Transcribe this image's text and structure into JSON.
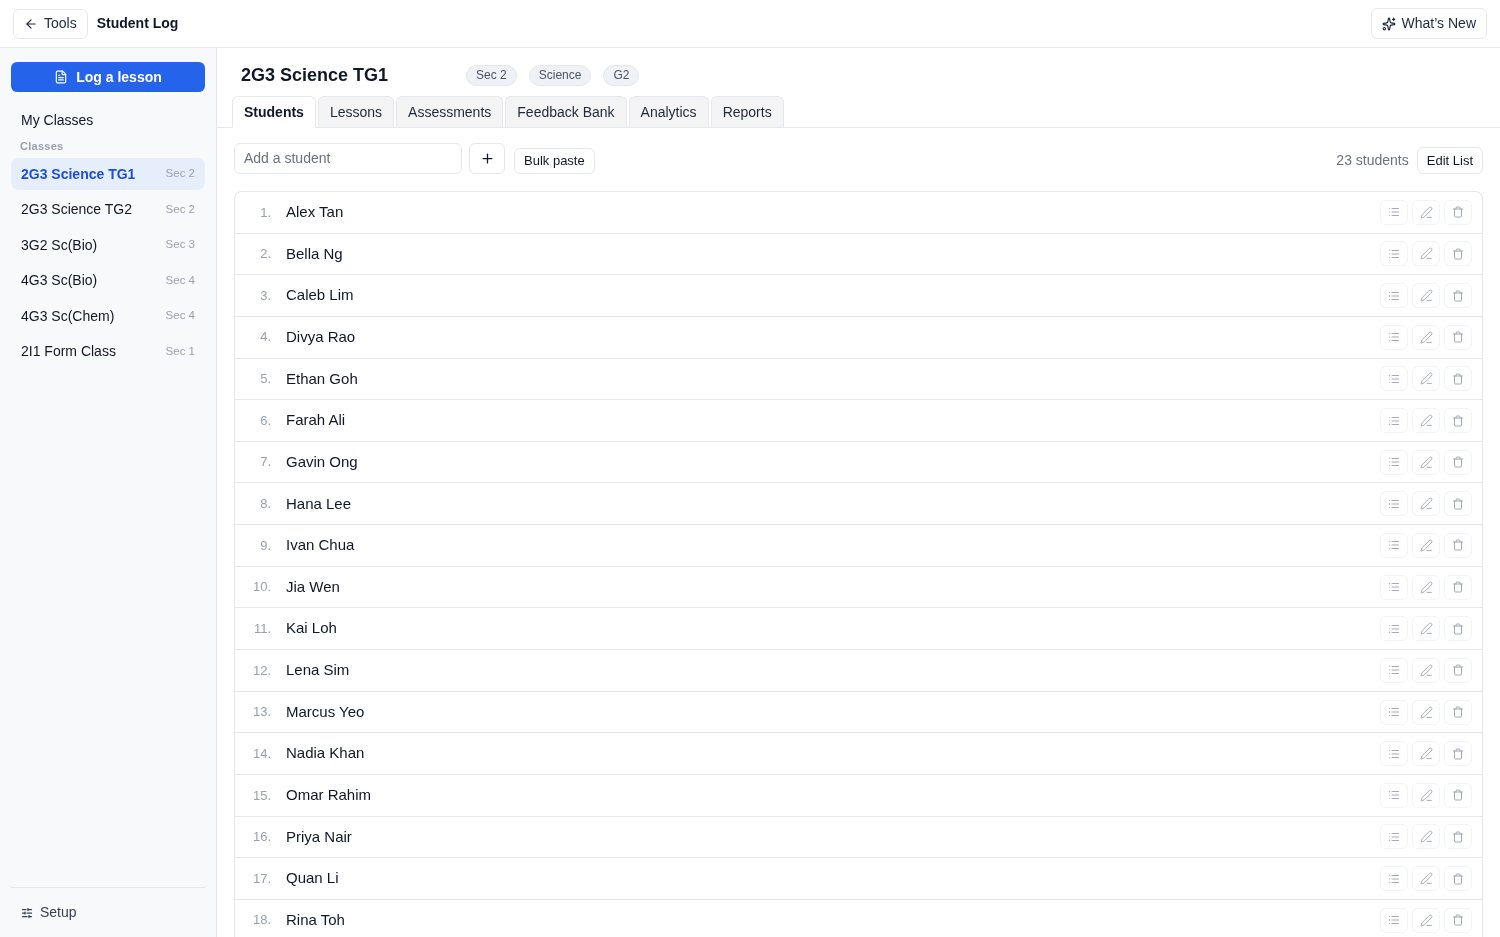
{
  "topbar": {
    "back_button": "Tools",
    "title": "Student Log",
    "whats_new_button": "What’s New"
  },
  "sidebar": {
    "primary_button": "Log a lesson",
    "my_classes": "My Classes",
    "section_label": "Classes",
    "classes": [
      {
        "name": "2G3 Science TG1",
        "badge": "Sec 2",
        "selected": true
      },
      {
        "name": "2G3 Science TG2",
        "badge": "Sec 2",
        "selected": false
      },
      {
        "name": "3G2 Sc(Bio)",
        "badge": "Sec 3",
        "selected": false
      },
      {
        "name": "4G3 Sc(Bio)",
        "badge": "Sec 4",
        "selected": false
      },
      {
        "name": "4G3 Sc(Chem)",
        "badge": "Sec 4",
        "selected": false
      },
      {
        "name": "2I1 Form Class",
        "badge": "Sec 1",
        "selected": false
      }
    ],
    "setup": "Setup"
  },
  "class_header": {
    "title": "2G3 Science TG1",
    "tags": [
      "Sec 2",
      "Science",
      "G2"
    ]
  },
  "tabs": [
    {
      "label": "Students",
      "selected": true
    },
    {
      "label": "Lessons",
      "selected": false
    },
    {
      "label": "Assessments",
      "selected": false
    },
    {
      "label": "Feedback Bank",
      "selected": false
    },
    {
      "label": "Analytics",
      "selected": false
    },
    {
      "label": "Reports",
      "selected": false
    }
  ],
  "toolbar": {
    "add_placeholder": "Add a student",
    "bulk_paste_button": "Bulk paste",
    "count": "23 students",
    "edit_button": "Edit List"
  },
  "students": [
    {
      "number": "1.",
      "name": "Alex Tan"
    },
    {
      "number": "2.",
      "name": "Bella Ng"
    },
    {
      "number": "3.",
      "name": "Caleb Lim"
    },
    {
      "number": "4.",
      "name": "Divya Rao"
    },
    {
      "number": "5.",
      "name": "Ethan Goh"
    },
    {
      "number": "6.",
      "name": "Farah Ali"
    },
    {
      "number": "7.",
      "name": "Gavin Ong"
    },
    {
      "number": "8.",
      "name": "Hana Lee"
    },
    {
      "number": "9.",
      "name": "Ivan Chua"
    },
    {
      "number": "10.",
      "name": "Jia Wen"
    },
    {
      "number": "11.",
      "name": "Kai Loh"
    },
    {
      "number": "12.",
      "name": "Lena Sim"
    },
    {
      "number": "13.",
      "name": "Marcus Yeo"
    },
    {
      "number": "14.",
      "name": "Nadia Khan"
    },
    {
      "number": "15.",
      "name": "Omar Rahim"
    },
    {
      "number": "16.",
      "name": "Priya Nair"
    },
    {
      "number": "17.",
      "name": "Quan Li"
    },
    {
      "number": "18.",
      "name": "Rina Toh"
    }
  ]
}
